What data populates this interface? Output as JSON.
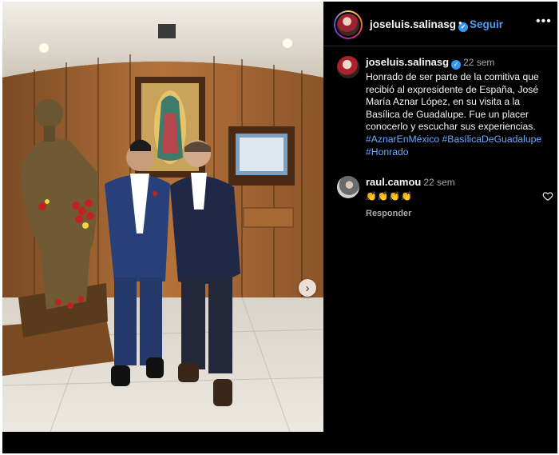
{
  "post": {
    "username": "joseluis.salinasg",
    "verified_mark": "✓",
    "separator": "•",
    "follow_label": "Seguir",
    "more_icon": "more-horizontal-icon",
    "more_glyph": "•••",
    "carousel_next_icon": "chevron-right-icon",
    "carousel_next_glyph": "›"
  },
  "caption": {
    "username": "joseluis.salinasg",
    "time": "22 sem",
    "text": "Honrado de ser parte de la comitiva que recibió al expresidente de España, José María Aznar López, en su visita a la Basílica de Guadalupe. Fue un placer conocerlo y escuchar sus experiencias.",
    "hashtags": [
      "#AznarEnMéxico",
      "#BasílicaDeGuadalupe",
      "#Honrado"
    ]
  },
  "comment": {
    "username": "raul.camou",
    "time": "22 sem",
    "text": "👏👏👏👏",
    "reply_label": "Responder",
    "like_icon": "heart-icon"
  },
  "colors": {
    "background": "#000000",
    "link_blue": "#4a9df7",
    "hashtag_blue": "#6ea8fe",
    "muted_text": "#a8a8a8",
    "verified_blue": "#3897f0"
  }
}
